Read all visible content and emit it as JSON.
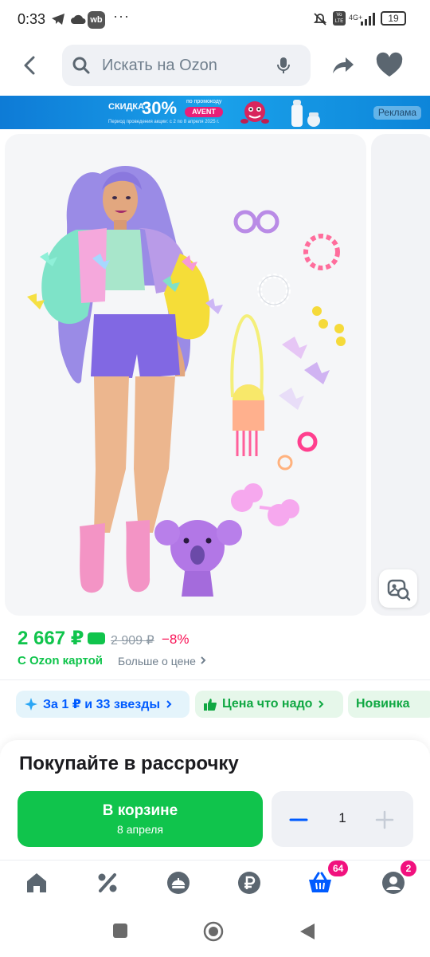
{
  "status_bar": {
    "time": "0:33",
    "wb_label": "wb",
    "menu_dots": "···",
    "network": "4G+",
    "battery": "19"
  },
  "header": {
    "search_placeholder": "Искать на Ozon"
  },
  "ad_banner": {
    "discount_word": "СКИДКА",
    "discount_value": "30%",
    "promo_caption": "по промокоду",
    "promo_code": "AVENT",
    "period": "Период проведения акции: с 2 по 8 апреля 2025 г.",
    "ad_label": "Реклама"
  },
  "product": {
    "price": "2 667 ₽",
    "old_price": "2 909 ₽",
    "discount": "−8%",
    "ozon_card_label": "С Ozon картой",
    "price_more_link": "Больше о цене"
  },
  "chips": [
    {
      "label": "За 1 ₽ и 33 звезды"
    },
    {
      "label": "Цена что надо"
    },
    {
      "label": "Новинка"
    }
  ],
  "purchase": {
    "installment_title": "Покупайте в рассрочку",
    "cart_button_label": "В корзине",
    "cart_button_sublabel": "8 апреля",
    "quantity": "1"
  },
  "bottom_nav": {
    "items": [
      {
        "icon": "home-icon"
      },
      {
        "icon": "percent-icon"
      },
      {
        "icon": "fresh-icon"
      },
      {
        "icon": "ruble-icon"
      },
      {
        "icon": "cart-icon",
        "badge": "64"
      },
      {
        "icon": "profile-icon",
        "badge": "2"
      }
    ]
  },
  "colors": {
    "accent_green": "#10c44c",
    "discount_red": "#f91155",
    "ozon_blue": "#005bff",
    "badge_pink": "#f1117e"
  }
}
